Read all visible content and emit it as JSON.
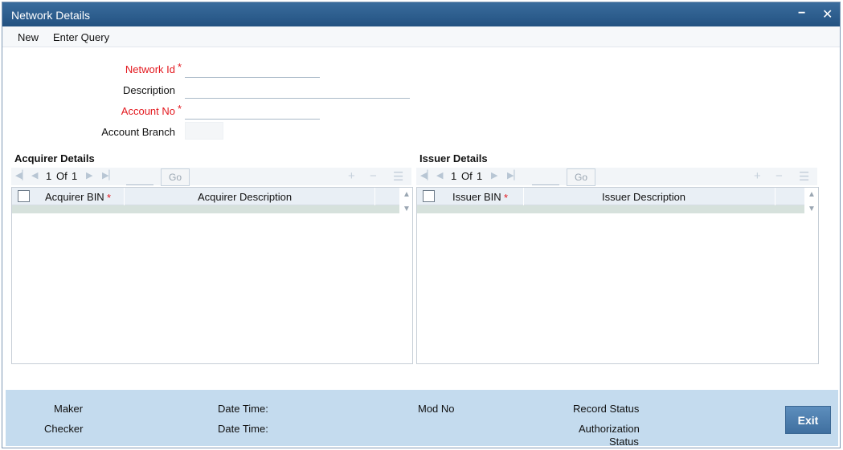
{
  "window": {
    "title": "Network Details",
    "minimize_icon": "minimize-icon",
    "close_icon": "close-icon"
  },
  "menu": {
    "new": "New",
    "enter_query": "Enter Query"
  },
  "form": {
    "network_id_label": "Network Id",
    "description_label": "Description",
    "account_no_label": "Account No",
    "account_branch_label": "Account Branch",
    "required_mark": "*"
  },
  "acquirer": {
    "title": "Acquirer Details",
    "page_current": "1",
    "page_of": "Of",
    "page_total": "1",
    "go_label": "Go",
    "columns": [
      "Acquirer BIN",
      "Acquirer Description"
    ]
  },
  "issuer": {
    "title": "Issuer Details",
    "page_current": "1",
    "page_of": "Of",
    "page_total": "1",
    "go_label": "Go",
    "columns": [
      "Issuer BIN",
      "Issuer Description"
    ]
  },
  "footer": {
    "maker": "Maker",
    "checker": "Checker",
    "date_time_1": "Date Time:",
    "date_time_2": "Date Time:",
    "mod_no": "Mod No",
    "record_status": "Record Status",
    "authorization": "Authorization",
    "status": "Status",
    "exit": "Exit"
  },
  "colors": {
    "titlebar": "#2d5d8d",
    "required": "#e3181e",
    "footer": "#c4dbee",
    "exit_button": "#4f7fad"
  }
}
